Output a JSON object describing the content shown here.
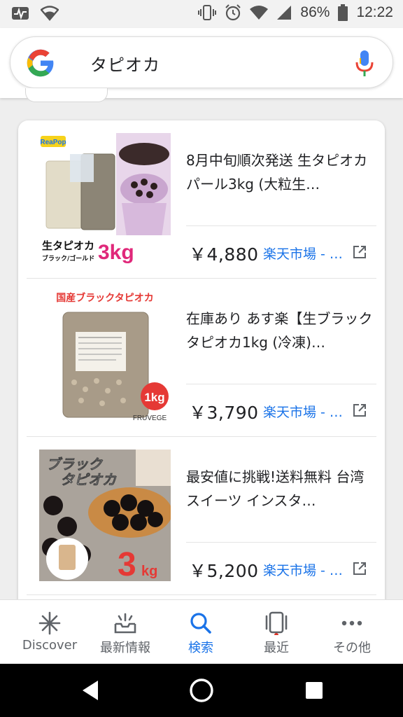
{
  "status_bar": {
    "battery": "86%",
    "time": "12:22"
  },
  "search": {
    "query": "タピオカ",
    "icons": [
      "google-logo",
      "mic-icon"
    ]
  },
  "colors": {
    "accent": "#1a73e8",
    "text": "#202124",
    "muted": "#5f6368"
  },
  "results": [
    {
      "title": "8月中旬順次発送 生タピオカパール3kg (大粒生…",
      "price": "￥4,880",
      "seller": "楽天市場 - …",
      "image_labels": [
        "ReaPop",
        "生タピオカ",
        "ブラック/ゴールド",
        "3kg"
      ]
    },
    {
      "title": "在庫あり あす楽【生ブラックタピオカ1kg (冷凍)…",
      "price": "￥3,790",
      "seller": "楽天市場 - …",
      "image_labels": [
        "国産ブラックタピオカ",
        "1kg",
        "FRUVEGE"
      ]
    },
    {
      "title": "最安値に挑戦!送料無料 台湾スイーツ インスタ…",
      "price": "￥5,200",
      "seller": "楽天市場 - …",
      "image_labels": [
        "ブラック",
        "タピオカ",
        "3",
        "kg"
      ]
    }
  ],
  "bottom_nav": [
    {
      "label": "Discover",
      "icon": "asterisk-icon"
    },
    {
      "label": "最新情報",
      "icon": "updates-tray-icon"
    },
    {
      "label": "検索",
      "icon": "search-icon",
      "active": true
    },
    {
      "label": "最近",
      "icon": "recent-cards-icon"
    },
    {
      "label": "その他",
      "icon": "more-dots-icon"
    }
  ]
}
